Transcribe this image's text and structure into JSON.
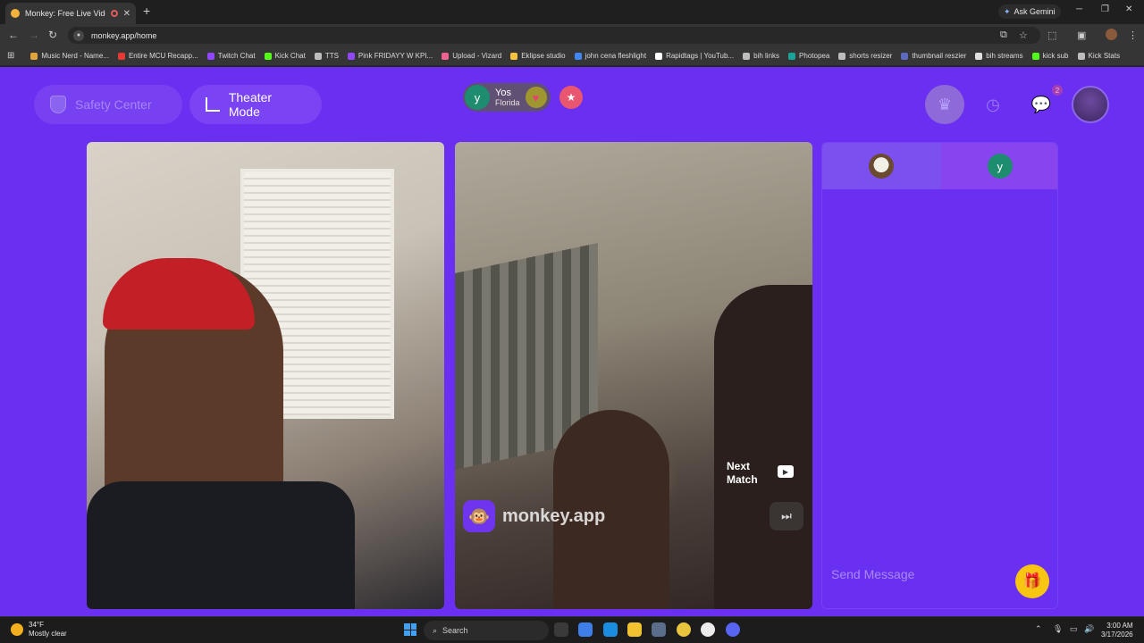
{
  "browser": {
    "tab_title": "Monkey: Free Live Video Ch",
    "new_tab": "+",
    "ask_gemini": "Ask Gemini",
    "url": "monkey.app/home",
    "bookmarks": [
      {
        "label": "Music Nerd - Name...",
        "color": "#e0a43a"
      },
      {
        "label": "Entire MCU Recapp...",
        "color": "#e53935"
      },
      {
        "label": "Twitch Chat",
        "color": "#9146ff"
      },
      {
        "label": "Kick Chat",
        "color": "#53fc18"
      },
      {
        "label": "TTS",
        "color": "#bdbdbd"
      },
      {
        "label": "Pink FRIDAYY W KPI...",
        "color": "#9146ff"
      },
      {
        "label": "Upload - Vizard",
        "color": "#f06292"
      },
      {
        "label": "Eklipse studio",
        "color": "#f5c542"
      },
      {
        "label": "john cena fleshlight",
        "color": "#4285f4"
      },
      {
        "label": "Rapidtags | YouTub...",
        "color": "#ffffff"
      },
      {
        "label": "bih links",
        "color": "#bdbdbd"
      },
      {
        "label": "Photopea",
        "color": "#18a497"
      },
      {
        "label": "shorts resizer",
        "color": "#bdbdbd"
      },
      {
        "label": "thumbnail reszier",
        "color": "#5c6bc0"
      },
      {
        "label": "bih streams",
        "color": "#e0e0e0"
      },
      {
        "label": "kick sub",
        "color": "#53fc18"
      },
      {
        "label": "Kick Stats",
        "color": "#bdbdbd"
      }
    ]
  },
  "app": {
    "safety_center": "Safety Center",
    "theater_mode": "Theater Mode",
    "notification_count": "2",
    "match": {
      "avatar_letter": "y",
      "name": "Yos",
      "location": "Florida"
    },
    "brand": "monkey.app",
    "next_match": "Next Match",
    "next_match_line1": "Next",
    "next_match_line2": "Match",
    "chat_tab_letter": "y",
    "message_placeholder": "Send Message"
  },
  "taskbar": {
    "temp": "34°F",
    "weather": "Mostly clear",
    "search": "Search",
    "time": "3:00 AM",
    "date": "3/17/2026"
  },
  "colors": {
    "page_bg": "#6a2ff0",
    "accent": "#7a43f3",
    "gift": "#f7c512"
  }
}
